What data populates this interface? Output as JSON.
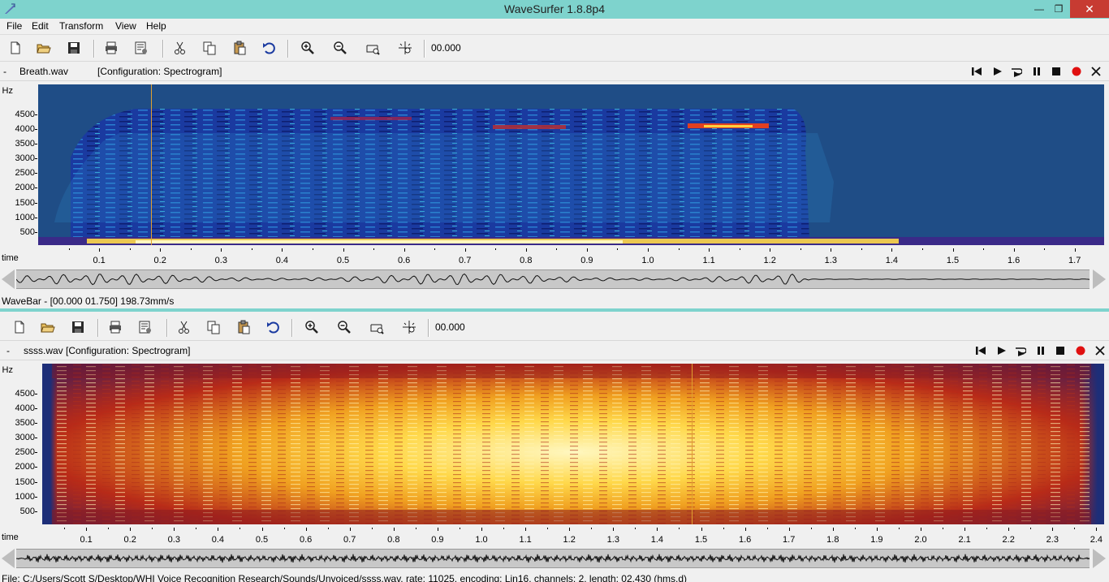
{
  "window": {
    "title": "WaveSurfer 1.8.8p4",
    "minimize": "—",
    "maximize": "❐",
    "close": "✕"
  },
  "menu": {
    "items": [
      "File",
      "Edit",
      "Transform",
      "View",
      "Help"
    ]
  },
  "toolbar1": {
    "time": "00.000"
  },
  "toolbar2": {
    "time": "00.000"
  },
  "pane1": {
    "dash": "-",
    "filename": "Breath.wav",
    "config": "[Configuration: Spectrogram]",
    "hz_title": "Hz",
    "hz_labels": [
      "4500",
      "4000",
      "3500",
      "3000",
      "2500",
      "2000",
      "1500",
      "1000",
      "500"
    ],
    "time_title": "time",
    "time_labels": [
      "0.1",
      "0.2",
      "0.3",
      "0.4",
      "0.5",
      "0.6",
      "0.7",
      "0.8",
      "0.9",
      "1.0",
      "1.1",
      "1.2",
      "1.3",
      "1.4",
      "1.5",
      "1.6",
      "1.7"
    ],
    "status": "WaveBar - [00.000 01.750] 198.73mm/s"
  },
  "pane2": {
    "dash": "-",
    "label": "ssss.wav [Configuration: Spectrogram]",
    "hz_title": "Hz",
    "hz_labels": [
      "4500",
      "4000",
      "3500",
      "3000",
      "2500",
      "2000",
      "1500",
      "1000",
      "500"
    ],
    "time_title": "time",
    "time_labels": [
      "0.1",
      "0.2",
      "0.3",
      "0.4",
      "0.5",
      "0.6",
      "0.7",
      "0.8",
      "0.9",
      "1.0",
      "1.1",
      "1.2",
      "1.3",
      "1.4",
      "1.5",
      "1.6",
      "1.7",
      "1.8",
      "1.9",
      "2.0",
      "2.1",
      "2.2",
      "2.3",
      "2.4"
    ],
    "status": "File: C:/Users/Scott S/Desktop/WHI Voice Recognition Research/Sounds/Unvoiced/ssss.wav, rate: 11025, encoding: Lin16, channels: 2, length: 02.430 (hms.d)"
  },
  "colors": {
    "titlebar": "#7ed3cd",
    "spec1_bg": "#1f4d86",
    "spec2_hot": "#ffd84a",
    "cursor": "#e0a030",
    "record": "#e01010"
  },
  "icons": [
    "new-file-icon",
    "open-folder-icon",
    "save-icon",
    "print-icon",
    "properties-icon",
    "cut-icon",
    "copy-icon",
    "paste-icon",
    "undo-icon",
    "zoom-in-icon",
    "zoom-out-icon",
    "zoom-fit-icon",
    "zoom-selection-icon"
  ]
}
